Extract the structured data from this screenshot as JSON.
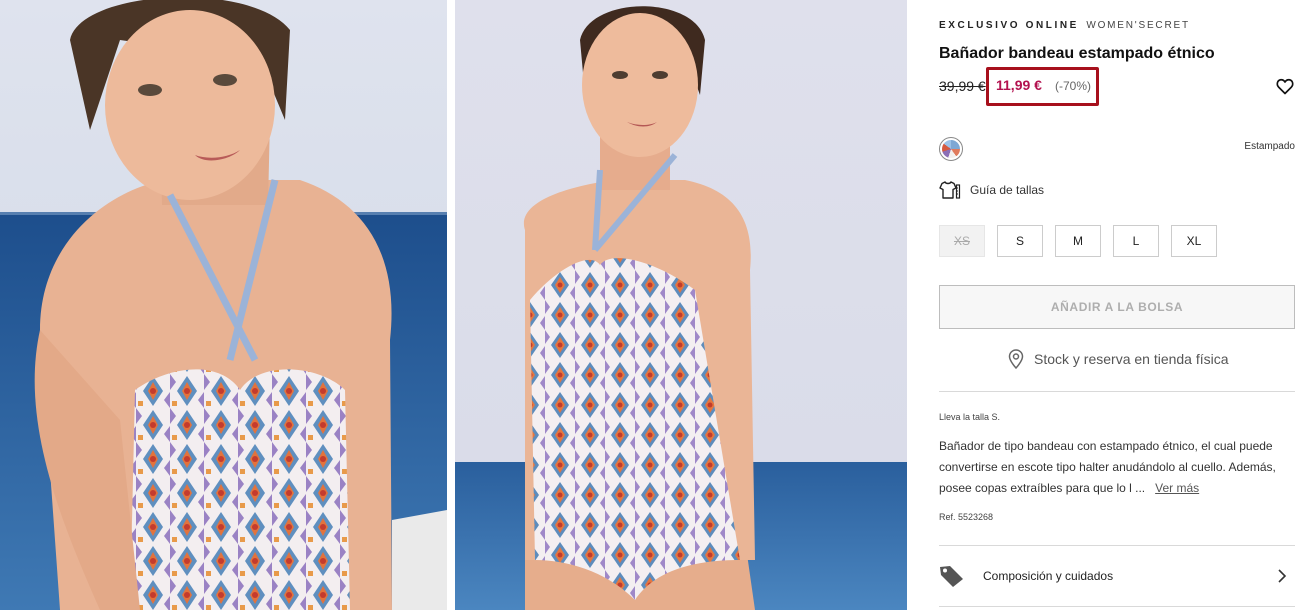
{
  "product": {
    "badge": "EXCLUSIVO ONLINE",
    "brand": "WOMEN'SECRET",
    "title": "Bañador bandeau estampado étnico",
    "old_price": "39,99 €",
    "price": "11,99 €",
    "discount": "(-70%)",
    "color_name": "Estampado",
    "size_guide_label": "Guía de tallas",
    "sizes": [
      {
        "label": "XS",
        "available": false
      },
      {
        "label": "S",
        "available": true
      },
      {
        "label": "M",
        "available": true
      },
      {
        "label": "L",
        "available": true
      },
      {
        "label": "XL",
        "available": true
      }
    ],
    "add_to_bag_label": "AÑADIR A LA BOLSA",
    "stock_label": "Stock y reserva en tienda física",
    "model_size": "Lleva la talla S.",
    "description": "Bañador de tipo bandeau con estampado étnico, el cual puede convertirse en escote tipo halter anudándolo al cuello. Además, posee copas extraíbles para que lo l ...",
    "read_more_label": "Ver más",
    "reference": "Ref. 5523268",
    "composition_label": "Composición y cuidados"
  },
  "icons": {
    "wishlist": "heart-icon",
    "size_guide": "t-shirt-ruler-icon",
    "stock": "location-pin-icon",
    "composition": "tag-icon",
    "expand": "chevron-right-icon"
  },
  "colors": {
    "price_accent": "#b3124f",
    "highlight_border": "#a7101c",
    "disabled_button_text": "#aeaeae"
  }
}
